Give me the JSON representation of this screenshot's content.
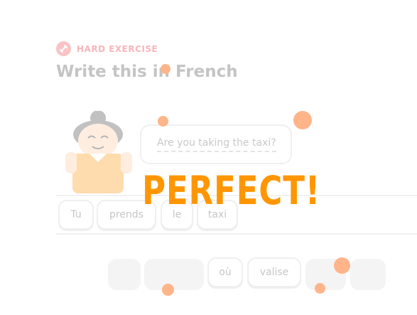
{
  "header": {
    "badge_label": "HARD EXERCISE",
    "badge_color": "#f7b6bb",
    "title": "Write this in French"
  },
  "prompt": {
    "text": "Are you taking the taxi?"
  },
  "answer_words": [
    "Tu",
    "prends",
    "le",
    "taxi"
  ],
  "word_bank": {
    "visible_words": [
      "où",
      "valise"
    ]
  },
  "feedback": {
    "text": "PERFECT!",
    "color": "#ff9600"
  }
}
